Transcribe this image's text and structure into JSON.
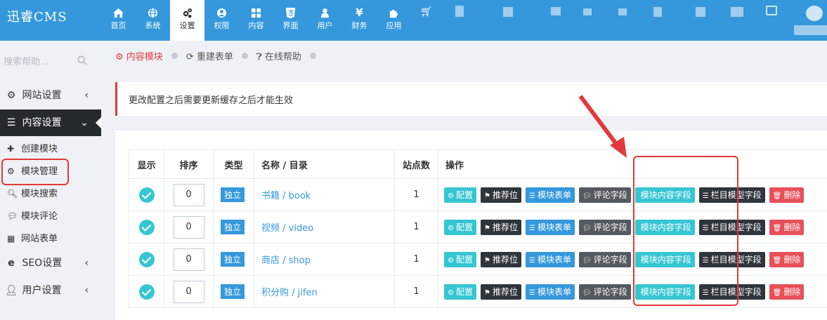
{
  "app": {
    "brand": "迅睿CMS"
  },
  "nav": [
    {
      "label": "首页",
      "icon": "home-icon"
    },
    {
      "label": "系统",
      "icon": "globe-icon"
    },
    {
      "label": "设置",
      "icon": "cogs-icon",
      "active": true
    },
    {
      "label": "权限",
      "icon": "user-circle-icon"
    },
    {
      "label": "内容",
      "icon": "grid-icon"
    },
    {
      "label": "界面",
      "icon": "html5-icon"
    },
    {
      "label": "用户",
      "icon": "user-icon"
    },
    {
      "label": "财务",
      "icon": "yen-icon"
    },
    {
      "label": "应用",
      "icon": "puzzle-icon"
    }
  ],
  "sidebar": {
    "search_placeholder": "搜索帮助...",
    "menus": [
      {
        "label": "网站设置",
        "icon": "gear-icon"
      },
      {
        "label": "内容设置",
        "icon": "list-icon",
        "open": true
      },
      {
        "label": "SEO设置",
        "icon": "ie-icon"
      },
      {
        "label": "用户设置",
        "icon": "user-icon"
      }
    ],
    "submenu": [
      {
        "label": "创建模块",
        "icon": "plus-icon"
      },
      {
        "label": "模块管理",
        "icon": "cogs-icon"
      },
      {
        "label": "模块搜索",
        "icon": "search-icon"
      },
      {
        "label": "模块评论",
        "icon": "comments-icon"
      },
      {
        "label": "网站表单",
        "icon": "table-icon"
      }
    ]
  },
  "breadcrumbs": [
    "内容模块",
    "重建表单",
    "在线帮助"
  ],
  "alert": "更改配置之后需要更新缓存之后才能生效",
  "table": {
    "headers": [
      "显示",
      "排序",
      "类型",
      "名称 / 目录",
      "站点数",
      "操作"
    ],
    "rows": [
      {
        "order": "0",
        "type": "独立",
        "name": "书籍 / book",
        "sites": "1"
      },
      {
        "order": "0",
        "type": "独立",
        "name": "视频 / video",
        "sites": "1"
      },
      {
        "order": "0",
        "type": "独立",
        "name": "商店 / shop",
        "sites": "1"
      },
      {
        "order": "0",
        "type": "独立",
        "name": "积分购 / jifen",
        "sites": "1"
      }
    ],
    "actions": [
      "配置",
      "推荐位",
      "模块表单",
      "评论字段",
      "模块内容字段",
      "栏目模型字段",
      "删除"
    ]
  },
  "colors": {
    "primary": "#3598dc",
    "dark": "#2f353b",
    "accent_red": "#e5383b",
    "cyan": "#36c6d3"
  }
}
